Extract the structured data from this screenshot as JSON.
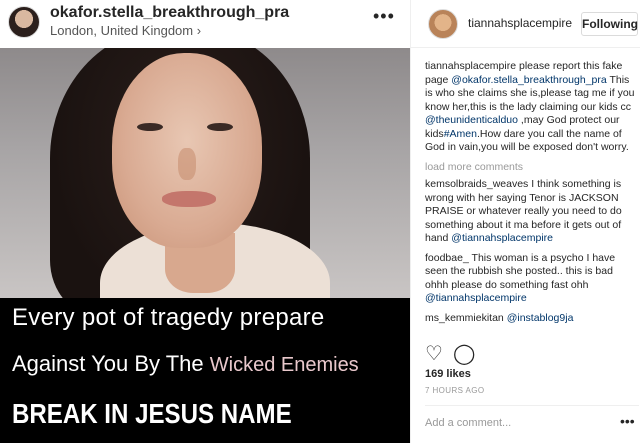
{
  "post": {
    "username": "okafor.stella_breakthrough_pra",
    "location": "London, United Kingdom",
    "location_chevron": "›",
    "more_icon": "•••"
  },
  "image_text": {
    "line1": "Every pot of tragedy prepare",
    "line2_a": "Against You By The ",
    "line2_b": "Wicked Enemies",
    "line3": "BREAK IN JESUS NAME"
  },
  "sidebar": {
    "username": "tiannahsplacempire",
    "follow_label": "Following",
    "comments": [
      {
        "user": "tiannahsplacempire",
        "parts": [
          {
            "t": " please report this fake page "
          },
          {
            "t": "@okafor.stella_breakthrough_pra",
            "m": true
          },
          {
            "t": " This is who she claims she is,please tag me if you know her,this is the lady claiming our kids cc "
          },
          {
            "t": "@theunidenticalduo",
            "m": true
          },
          {
            "t": " ,may God protect our kids"
          },
          {
            "t": "#Amen",
            "m": true
          },
          {
            "t": ".How dare you call the name of God in vain,you will be exposed don't worry."
          }
        ]
      }
    ],
    "load_more": "load more comments",
    "more_comments": [
      {
        "user": "kemsolbraids_weaves",
        "parts": [
          {
            "t": " I think something is wrong with her saying Tenor is JACKSON PRAISE or whatever really you need to do something about it ma before it gets out of hand "
          },
          {
            "t": "@tiannahsplacempire",
            "m": true
          }
        ]
      },
      {
        "user": "foodbae_",
        "parts": [
          {
            "t": " This woman is a psycho I have seen the rubbish she posted.. this is bad ohhh please do something fast ohh "
          },
          {
            "t": "@tiannahsplacempire",
            "m": true
          }
        ]
      },
      {
        "user": "ms_kemmiekitan",
        "parts": [
          {
            "t": " "
          },
          {
            "t": "@instablog9ja",
            "m": true
          }
        ]
      }
    ],
    "likes": "169 likes",
    "time": "7 HOURS AGO",
    "add_comment_placeholder": "Add a comment...",
    "more_icon": "•••"
  }
}
